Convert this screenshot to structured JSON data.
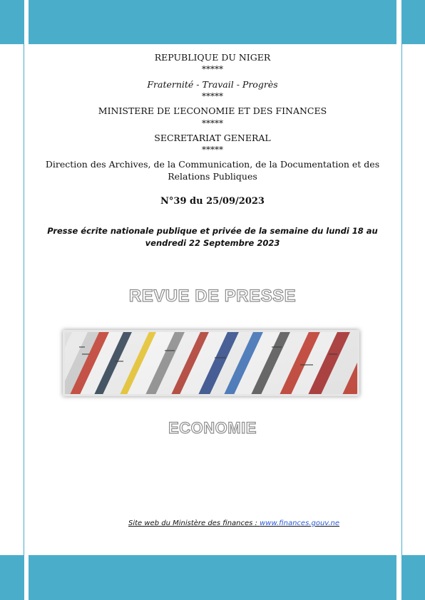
{
  "header": {
    "country": "REPUBLIQUE DU NIGER",
    "separator": "*****",
    "motto": "Fraternité - Travail - Progrès",
    "ministry": "MINISTERE DE L’ECONOMIE ET DES FINANCES",
    "secretariat": "SECRETARIAT GENERAL",
    "direction_line1": "Direction des Archives, de la Communication, de la Documentation et des",
    "direction_line2": "Relations Publiques"
  },
  "issue": {
    "number": "N°39 du 25/09/2023",
    "description_line1": "Presse écrite nationale publique et privée de la semaine du lundi 18 au",
    "description_line2": "vendredi 22 Septembre 2023"
  },
  "title": "REVUE DE PRESSE",
  "section": "ECONOMIE",
  "footer": {
    "website_label": "Site web du Ministère des finances : ",
    "website_url": "www.finances.gouv.ne"
  },
  "colors": {
    "accent_band": "#4aaecb",
    "link": "#2a5bd7"
  }
}
